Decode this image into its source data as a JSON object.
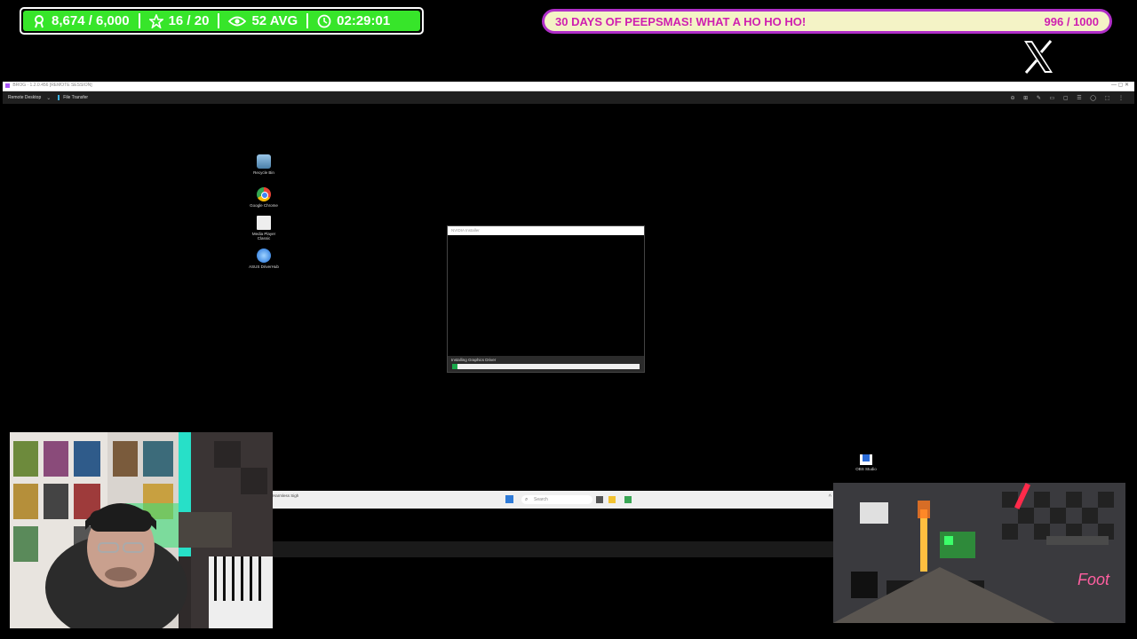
{
  "stats": {
    "followers": "8,674 / 6,000",
    "subs": "16 / 20",
    "viewers": "52 AVG",
    "uptime": "02:29:01"
  },
  "goal": {
    "title": "30 DAYS OF PEEPSMAS! WHAT A HO HO HO!",
    "progress": "996 / 1000",
    "progress_fraction": 0.996
  },
  "remote": {
    "title": "BROG · 1.2.0.456 [REMOTE SESSION]",
    "tab_remote": "Remote Desktop",
    "tab_file": "File Transfer",
    "desktop_icons": [
      {
        "label": "Recycle Bin",
        "icon": "recycle-bin-icon"
      },
      {
        "label": "Google Chrome",
        "icon": "chrome-icon"
      },
      {
        "label": "Media Player Classic",
        "icon": "media-player-icon"
      },
      {
        "label": "ASUS DriverHub",
        "icon": "driverhub-icon"
      }
    ],
    "installer": {
      "title": "NVIDIA Installer",
      "status": "Installing Graphics Driver",
      "progress_fraction": 0.03
    },
    "taskbar": {
      "weather": "Harmless Sigh",
      "search_placeholder": "Search"
    },
    "obs_label": "OBS Studio"
  },
  "colors": {
    "stats_green": "#37e52a",
    "goal_bg": "#f4f3c6",
    "goal_text": "#cf1fb0",
    "goal_border": "#b02ec8"
  }
}
